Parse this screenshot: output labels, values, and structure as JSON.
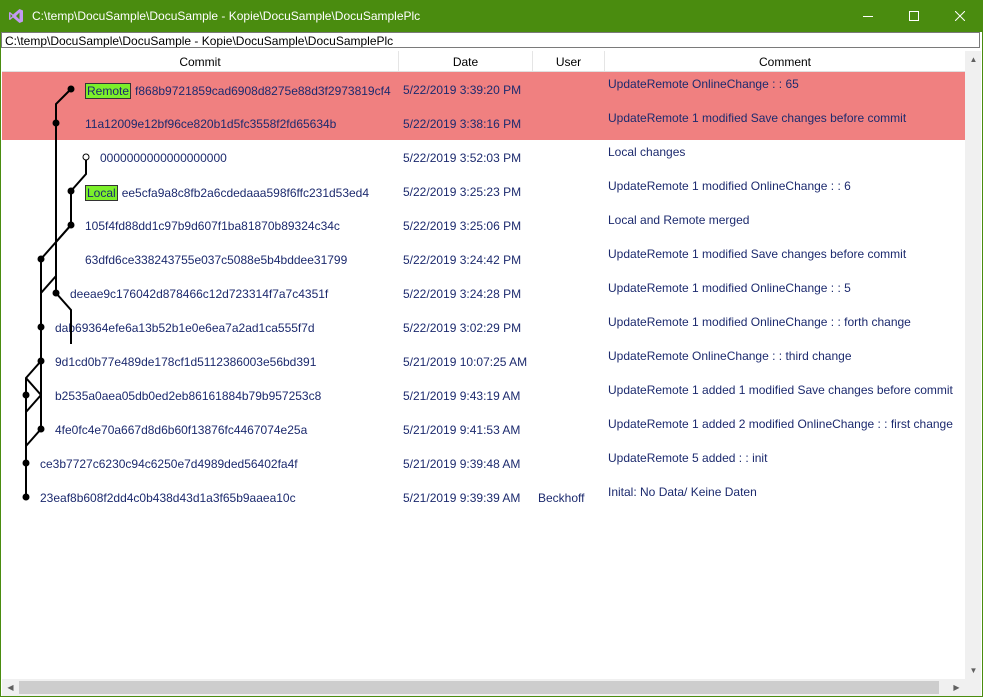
{
  "window": {
    "title": "C:\\temp\\DocuSample\\DocuSample - Kopie\\DocuSample\\DocuSamplePlc",
    "icon": "visual-studio-icon",
    "accent": "#4a8c0f"
  },
  "path": "C:\\temp\\DocuSample\\DocuSample - Kopie\\DocuSample\\DocuSamplePlc",
  "columns": {
    "commit": "Commit",
    "date": "Date",
    "user": "User",
    "comment": "Comment"
  },
  "colors": {
    "selected_row": "#f08080",
    "ref_tag": "#7cf02a",
    "text": "#1c2a6e"
  },
  "rows": [
    {
      "tag": "Remote",
      "hash": "f868b9721859cad6908d8275e88d3f2973819cf4",
      "date": "5/22/2019 3:39:20 PM",
      "user": "",
      "comment": "UpdateRemote  OnlineChange :  : 65",
      "selected": true
    },
    {
      "tag": "",
      "hash": "11a12009e12bf96ce820b1d5fc3558f2fd65634b",
      "date": "5/22/2019 3:38:16 PM",
      "user": "",
      "comment": "UpdateRemote 1 modified  Save changes before commit",
      "selected": true
    },
    {
      "tag": "",
      "hash": "0000000000000000000",
      "date": "5/22/2019 3:52:03 PM",
      "user": "",
      "comment": "Local changes",
      "selected": false
    },
    {
      "tag": "Local",
      "hash": "ee5cfa9a8c8fb2a6cdedaaa598f6ffc231d53ed4",
      "date": "5/22/2019 3:25:23 PM",
      "user": "",
      "comment": "UpdateRemote 1 modified  OnlineChange :  : 6",
      "selected": false
    },
    {
      "tag": "",
      "hash": "105f4fd88dd1c97b9d607f1ba81870b89324c34c",
      "date": "5/22/2019 3:25:06 PM",
      "user": "",
      "comment": "Local and Remote merged",
      "selected": false
    },
    {
      "tag": "",
      "hash": "63dfd6ce338243755e037c5088e5b4bddee31799",
      "date": "5/22/2019 3:24:42 PM",
      "user": "",
      "comment": "UpdateRemote 1 modified  Save changes before commit",
      "selected": false
    },
    {
      "tag": "",
      "hash": "deeae9c176042d878466c12d723314f7a7c4351f",
      "date": "5/22/2019 3:24:28 PM",
      "user": "",
      "comment": "UpdateRemote 1 modified  OnlineChange :  : 5",
      "selected": false
    },
    {
      "tag": "",
      "hash": "dab69364efe6a13b52b1e0e6ea7a2ad1ca555f7d",
      "date": "5/22/2019 3:02:29 PM",
      "user": "",
      "comment": "UpdateRemote 1 modified  OnlineChange :  : forth change",
      "selected": false
    },
    {
      "tag": "",
      "hash": "9d1cd0b77e489de178cf1d5112386003e56bd391",
      "date": "5/21/2019 10:07:25 AM",
      "user": "",
      "comment": "UpdateRemote  OnlineChange :  : third change",
      "selected": false
    },
    {
      "tag": "",
      "hash": "b2535a0aea05db0ed2eb86161884b79b957253c8",
      "date": "5/21/2019 9:43:19 AM",
      "user": "",
      "comment": "UpdateRemote 1 added 1 modified  Save changes before commit",
      "selected": false
    },
    {
      "tag": "",
      "hash": "4fe0fc4e70a667d8d6b60f13876fc4467074e25a",
      "date": "5/21/2019 9:41:53 AM",
      "user": "",
      "comment": "UpdateRemote 1 added 2 modified  OnlineChange :  : first change",
      "selected": false
    },
    {
      "tag": "",
      "hash": "ce3b7727c6230c94c6250e7d4989ded56402fa4f",
      "date": "5/21/2019 9:39:48 AM",
      "user": "",
      "comment": "UpdateRemote 5 added   :  : init",
      "selected": false
    },
    {
      "tag": "",
      "hash": "23eaf8b608f2dd4c0b438d43d1a3f65b9aaea10c",
      "date": "5/21/2019 9:39:39 AM",
      "user": "Beckhoff",
      "comment": "Inital: No Data/ Keine Daten",
      "selected": false
    }
  ]
}
